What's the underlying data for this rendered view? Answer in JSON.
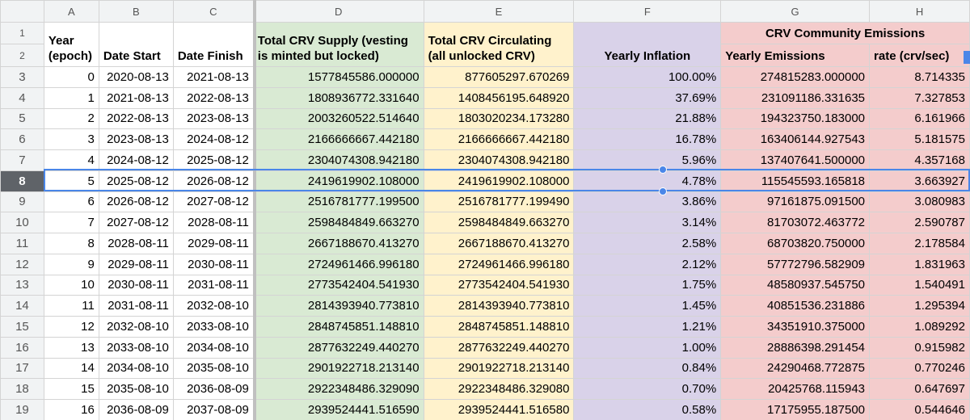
{
  "columns": [
    "A",
    "B",
    "C",
    "D",
    "E",
    "F",
    "G",
    "H"
  ],
  "header": {
    "year": "Year (epoch)",
    "date_start": "Date Start",
    "date_finish": "Date Finish",
    "total_supply": "Total CRV Supply (vesting is minted but locked)",
    "circulating": "Total CRV Circulating (all unlocked CRV)",
    "inflation": "Yearly Inflation",
    "group_emissions": "CRV Community Emissions",
    "yearly_emissions": "Yearly Emissions",
    "rate": "rate (crv/sec)"
  },
  "rows": [
    {
      "n": "3",
      "year": "0",
      "start": "2020-08-13",
      "finish": "2021-08-13",
      "supply": "1577845586.000000",
      "circ": "877605297.670269",
      "infl": "100.00%",
      "emis": "274815283.000000",
      "rate": "8.714335"
    },
    {
      "n": "4",
      "year": "1",
      "start": "2021-08-13",
      "finish": "2022-08-13",
      "supply": "1808936772.331640",
      "circ": "1408456195.648920",
      "infl": "37.69%",
      "emis": "231091186.331635",
      "rate": "7.327853"
    },
    {
      "n": "5",
      "year": "2",
      "start": "2022-08-13",
      "finish": "2023-08-13",
      "supply": "2003260522.514640",
      "circ": "1803020234.173280",
      "infl": "21.88%",
      "emis": "194323750.183000",
      "rate": "6.161966"
    },
    {
      "n": "6",
      "year": "3",
      "start": "2023-08-13",
      "finish": "2024-08-12",
      "supply": "2166666667.442180",
      "circ": "2166666667.442180",
      "infl": "16.78%",
      "emis": "163406144.927543",
      "rate": "5.181575"
    },
    {
      "n": "7",
      "year": "4",
      "start": "2024-08-12",
      "finish": "2025-08-12",
      "supply": "2304074308.942180",
      "circ": "2304074308.942180",
      "infl": "5.96%",
      "emis": "137407641.500000",
      "rate": "4.357168"
    },
    {
      "n": "8",
      "year": "5",
      "start": "2025-08-12",
      "finish": "2026-08-12",
      "supply": "2419619902.108000",
      "circ": "2419619902.108000",
      "infl": "4.78%",
      "emis": "115545593.165818",
      "rate": "3.663927"
    },
    {
      "n": "9",
      "year": "6",
      "start": "2026-08-12",
      "finish": "2027-08-12",
      "supply": "2516781777.199500",
      "circ": "2516781777.199490",
      "infl": "3.86%",
      "emis": "97161875.091500",
      "rate": "3.080983"
    },
    {
      "n": "10",
      "year": "7",
      "start": "2027-08-12",
      "finish": "2028-08-11",
      "supply": "2598484849.663270",
      "circ": "2598484849.663270",
      "infl": "3.14%",
      "emis": "81703072.463772",
      "rate": "2.590787"
    },
    {
      "n": "11",
      "year": "8",
      "start": "2028-08-11",
      "finish": "2029-08-11",
      "supply": "2667188670.413270",
      "circ": "2667188670.413270",
      "infl": "2.58%",
      "emis": "68703820.750000",
      "rate": "2.178584"
    },
    {
      "n": "12",
      "year": "9",
      "start": "2029-08-11",
      "finish": "2030-08-11",
      "supply": "2724961466.996180",
      "circ": "2724961466.996180",
      "infl": "2.12%",
      "emis": "57772796.582909",
      "rate": "1.831963"
    },
    {
      "n": "13",
      "year": "10",
      "start": "2030-08-11",
      "finish": "2031-08-11",
      "supply": "2773542404.541930",
      "circ": "2773542404.541930",
      "infl": "1.75%",
      "emis": "48580937.545750",
      "rate": "1.540491"
    },
    {
      "n": "14",
      "year": "11",
      "start": "2031-08-11",
      "finish": "2032-08-10",
      "supply": "2814393940.773810",
      "circ": "2814393940.773810",
      "infl": "1.45%",
      "emis": "40851536.231886",
      "rate": "1.295394"
    },
    {
      "n": "15",
      "year": "12",
      "start": "2032-08-10",
      "finish": "2033-08-10",
      "supply": "2848745851.148810",
      "circ": "2848745851.148810",
      "infl": "1.21%",
      "emis": "34351910.375000",
      "rate": "1.089292"
    },
    {
      "n": "16",
      "year": "13",
      "start": "2033-08-10",
      "finish": "2034-08-10",
      "supply": "2877632249.440270",
      "circ": "2877632249.440270",
      "infl": "1.00%",
      "emis": "28886398.291454",
      "rate": "0.915982"
    },
    {
      "n": "17",
      "year": "14",
      "start": "2034-08-10",
      "finish": "2035-08-10",
      "supply": "2901922718.213140",
      "circ": "2901922718.213140",
      "infl": "0.84%",
      "emis": "24290468.772875",
      "rate": "0.770246"
    },
    {
      "n": "18",
      "year": "15",
      "start": "2035-08-10",
      "finish": "2036-08-09",
      "supply": "2922348486.329090",
      "circ": "2922348486.329080",
      "infl": "0.70%",
      "emis": "20425768.115943",
      "rate": "0.647697"
    },
    {
      "n": "19",
      "year": "16",
      "start": "2036-08-09",
      "finish": "2037-08-09",
      "supply": "2939524441.516590",
      "circ": "2939524441.516580",
      "infl": "0.58%",
      "emis": "17175955.187500",
      "rate": "0.544646"
    }
  ],
  "selected_row": "8",
  "colors": {
    "green": "#d9ead3",
    "yellow": "#fff2cc",
    "purple": "#d9d2e9",
    "red": "#f4cccc",
    "selection": "#4a86e8"
  }
}
